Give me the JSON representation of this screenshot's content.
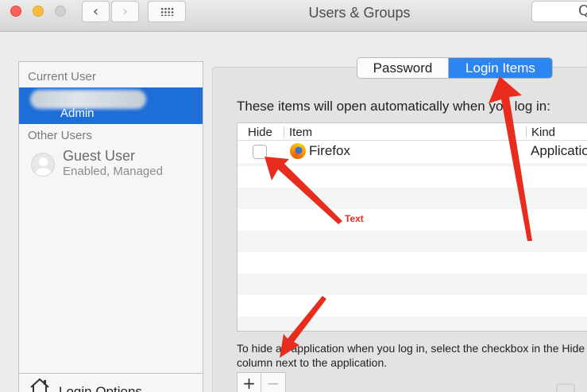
{
  "window": {
    "title": "Users & Groups"
  },
  "toolbar": {
    "back_glyph": "‹",
    "forward_glyph": "›",
    "search_glyph": "Q"
  },
  "sidebar": {
    "current_user_heading": "Current User",
    "current_user": {
      "name": "",
      "role": "Admin"
    },
    "other_users_heading": "Other Users",
    "guest_user": {
      "name": "Guest User",
      "status": "Enabled, Managed"
    },
    "login_options_label": "Login Options"
  },
  "tabs": {
    "password_label": "Password",
    "login_items_label": "Login Items",
    "selected": "Login Items"
  },
  "login_items": {
    "intro": "These items will open automatically when you log in:",
    "columns": {
      "hide": "Hide",
      "item": "Item",
      "kind": "Kind"
    },
    "rows": [
      {
        "hide": false,
        "item": "Firefox",
        "kind": "Application",
        "icon": "firefox-icon"
      }
    ],
    "help_text_line1": "To hide an application when you log in, select the checkbox in the Hide",
    "help_text_line2": "column next to the application.",
    "add_glyph": "+",
    "remove_glyph": "−"
  },
  "annotations": {
    "label": "Text",
    "color": "#e82d1e"
  },
  "colors": {
    "selection": "#1e6ed8",
    "segment_active": "#2d86ef",
    "annotation": "#e82d1e"
  }
}
